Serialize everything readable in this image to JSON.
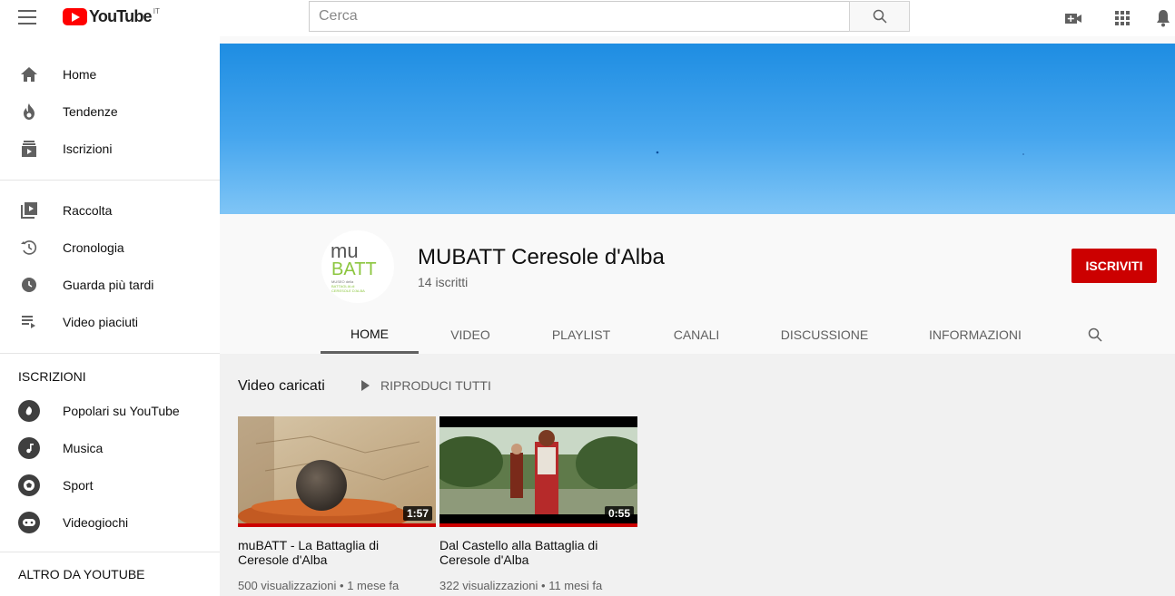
{
  "header": {
    "logo_text": "YouTube",
    "country_code": "IT",
    "search_placeholder": "Cerca",
    "icons": [
      "menu-icon",
      "search-icon",
      "video-camera-icon",
      "apps-grid-icon",
      "bell-icon"
    ]
  },
  "sidebar": {
    "main_items": [
      {
        "label": "Home",
        "icon": "home-icon"
      },
      {
        "label": "Tendenze",
        "icon": "flame-icon"
      },
      {
        "label": "Iscrizioni",
        "icon": "subscriptions-icon"
      }
    ],
    "library_items": [
      {
        "label": "Raccolta",
        "icon": "library-icon"
      },
      {
        "label": "Cronologia",
        "icon": "history-icon"
      },
      {
        "label": "Guarda più tardi",
        "icon": "clock-icon"
      },
      {
        "label": "Video piaciuti",
        "icon": "liked-videos-icon"
      }
    ],
    "subscriptions_title": "ISCRIZIONI",
    "subscriptions": [
      {
        "label": "Popolari su YouTube",
        "icon": "popular-icon"
      },
      {
        "label": "Musica",
        "icon": "music-icon"
      },
      {
        "label": "Sport",
        "icon": "sport-icon"
      },
      {
        "label": "Videogiochi",
        "icon": "gaming-icon"
      }
    ],
    "more_title": "ALTRO DA YOUTUBE"
  },
  "channel": {
    "name": "MUBATT Ceresole d'Alba",
    "subscribers": "14 iscritti",
    "subscribe_label": "ISCRIVITI",
    "avatar_logo": {
      "line1": "mu",
      "line2": "BATT",
      "small_text": "MUSEO della BATTAGLIA di CERESOLE D'ALBA"
    },
    "tabs": [
      "HOME",
      "VIDEO",
      "PLAYLIST",
      "CANALI",
      "DISCUSSIONE",
      "INFORMAZIONI"
    ],
    "active_tab": "HOME"
  },
  "uploads": {
    "section_title": "Video caricati",
    "play_all_label": "RIPRODUCI TUTTI",
    "videos": [
      {
        "title": "muBATT - La Battaglia di Ceresole d'Alba",
        "duration": "1:57",
        "views": "500 visualizzazioni",
        "age": "1 mese fa",
        "watched_fraction": 1.0
      },
      {
        "title": "Dal Castello alla Battaglia di Ceresole d'Alba",
        "duration": "0:55",
        "views": "322 visualizzazioni",
        "age": "11 mesi fa",
        "watched_fraction": 1.0
      }
    ]
  },
  "colors": {
    "brand_red": "#ff0000",
    "subscribe_red": "#cc0000",
    "banner_blue": "#2b95e6",
    "logo_green": "#8cc63f"
  }
}
